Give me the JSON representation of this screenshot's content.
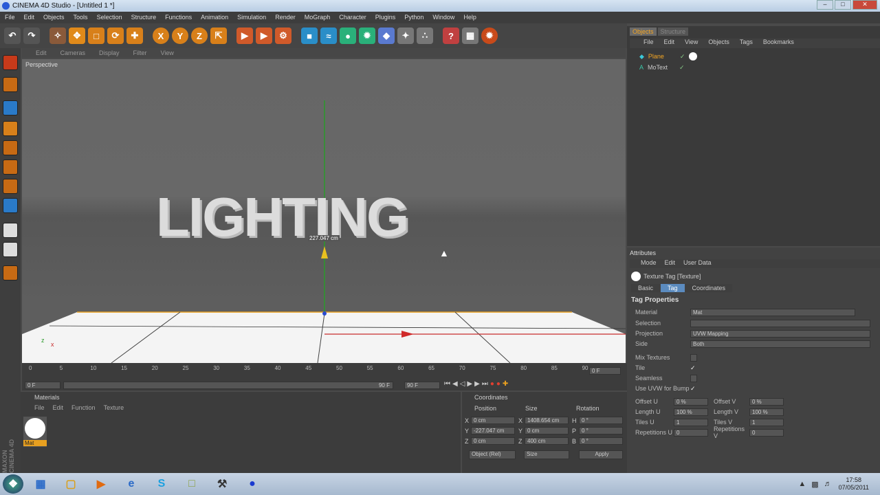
{
  "window": {
    "title": "CINEMA 4D Studio - [Untitled 1 *]"
  },
  "menu": [
    "File",
    "Edit",
    "Objects",
    "Tools",
    "Selection",
    "Structure",
    "Functions",
    "Animation",
    "Simulation",
    "Render",
    "MoGraph",
    "Character",
    "Plugins",
    "Python",
    "Window",
    "Help"
  ],
  "toolbar": {
    "axis_x": "X",
    "axis_y": "Y",
    "axis_z": "Z"
  },
  "viewport": {
    "menu": [
      "Edit",
      "Cameras",
      "Display",
      "Filter",
      "View"
    ],
    "label": "Perspective",
    "scene_text": "LIGHTING",
    "measure": "227.047 cm"
  },
  "objects_panel": {
    "tabs": [
      "Objects",
      "Structure"
    ],
    "menu": [
      "File",
      "Edit",
      "View",
      "Objects",
      "Tags",
      "Bookmarks"
    ],
    "items": [
      "Plane",
      "MoText"
    ]
  },
  "attributes": {
    "title": "Attributes",
    "menu": [
      "Mode",
      "Edit",
      "User Data"
    ],
    "tag_title": "Texture Tag [Texture]",
    "subtabs": [
      "Basic",
      "Tag",
      "Coordinates"
    ],
    "section": "Tag Properties",
    "material_label": "Material",
    "material_value": "Mat",
    "selection_label": "Selection",
    "projection_label": "Projection",
    "projection_value": "UVW Mapping",
    "side_label": "Side",
    "side_value": "Both",
    "mix_label": "Mix Textures",
    "tile_label": "Tile",
    "seamless_label": "Seamless",
    "uvw_bump_label": "Use UVW for Bump",
    "offset_u_label": "Offset U",
    "offset_u": "0 %",
    "offset_v_label": "Offset V",
    "offset_v": "0 %",
    "length_u_label": "Length U",
    "length_u": "100 %",
    "length_v_label": "Length V",
    "length_v": "100 %",
    "tiles_u_label": "Tiles U",
    "tiles_u": "1",
    "tiles_v_label": "Tiles V",
    "tiles_v": "1",
    "rep_u_label": "Repetitions U",
    "rep_u": "0",
    "rep_v_label": "Repetitions V",
    "rep_v": "0"
  },
  "timeline": {
    "ticks": [
      "0",
      "5",
      "10",
      "15",
      "20",
      "25",
      "30",
      "35",
      "40",
      "45",
      "50",
      "55",
      "60",
      "65",
      "70",
      "75",
      "80",
      "85",
      "90"
    ],
    "frame_field": "0 F",
    "start": "0 F",
    "end_a": "90 F",
    "end_b": "90 F",
    "current": "0 F"
  },
  "materials": {
    "title": "Materials",
    "menu": [
      "File",
      "Edit",
      "Function",
      "Texture"
    ],
    "material_name": "Mat"
  },
  "coordinates": {
    "title": "Coordinates",
    "col_position": "Position",
    "col_size": "Size",
    "col_rotation": "Rotation",
    "px_label": "X",
    "px": "0 cm",
    "py_label": "Y",
    "py": "-227.047 cm",
    "pz_label": "Z",
    "pz": "0 cm",
    "sx_label": "X",
    "sx": "1408.654 cm",
    "sy_label": "Y",
    "sy": "0 cm",
    "sz_label": "Z",
    "sz": "400 cm",
    "rh_label": "H",
    "rh": "0 °",
    "rp_label": "P",
    "rp": "0 °",
    "rb_label": "B",
    "rb": "0 °",
    "mode": "Object (Rel)",
    "size_mode": "Size",
    "apply": "Apply"
  },
  "branding": {
    "maxon": "MAXON CINEMA 4D"
  },
  "taskbar": {
    "time": "17:58",
    "date": "07/05/2011"
  }
}
